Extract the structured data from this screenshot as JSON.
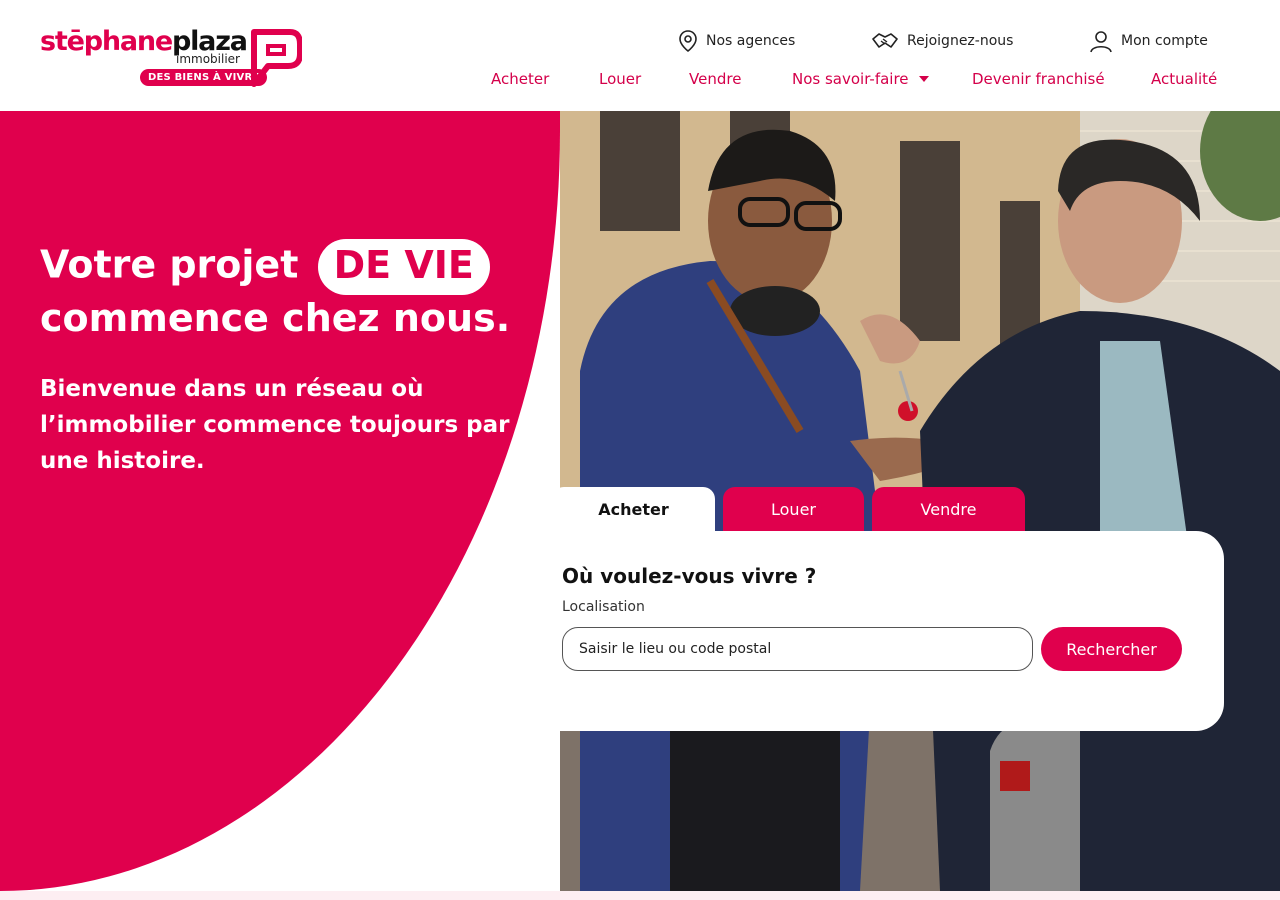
{
  "brand": {
    "name_part1": "stēphane",
    "name_part2": "plaza",
    "sub": "immobilier",
    "badge": "DES BIENS À VIVRE"
  },
  "util_nav": [
    {
      "label": "Nos agences",
      "icon": "map-pin-icon"
    },
    {
      "label": "Rejoignez-nous",
      "icon": "handshake-icon"
    },
    {
      "label": "Mon compte",
      "icon": "user-icon"
    }
  ],
  "main_nav": [
    {
      "label": "Acheter"
    },
    {
      "label": "Louer"
    },
    {
      "label": "Vendre"
    },
    {
      "label": "Nos savoir-faire",
      "dropdown": true
    },
    {
      "label": "Devenir franchisé"
    },
    {
      "label": "Actualité"
    }
  ],
  "hero": {
    "title_line1": "Votre projet",
    "title_highlight": "DE VIE",
    "title_line2": "commence chez nous.",
    "subtitle": "Bienvenue dans un réseau où l’immobilier commence toujours par une histoire."
  },
  "search": {
    "tabs": [
      {
        "label": "Acheter",
        "active": true
      },
      {
        "label": "Louer",
        "active": false
      },
      {
        "label": "Vendre",
        "active": false
      }
    ],
    "title": "Où voulez-vous vivre ?",
    "field_label": "Localisation",
    "placeholder": "Saisir le lieu ou code postal",
    "button": "Rechercher"
  },
  "colors": {
    "brand_pink": "#e0004d",
    "text_dark": "#111111"
  }
}
